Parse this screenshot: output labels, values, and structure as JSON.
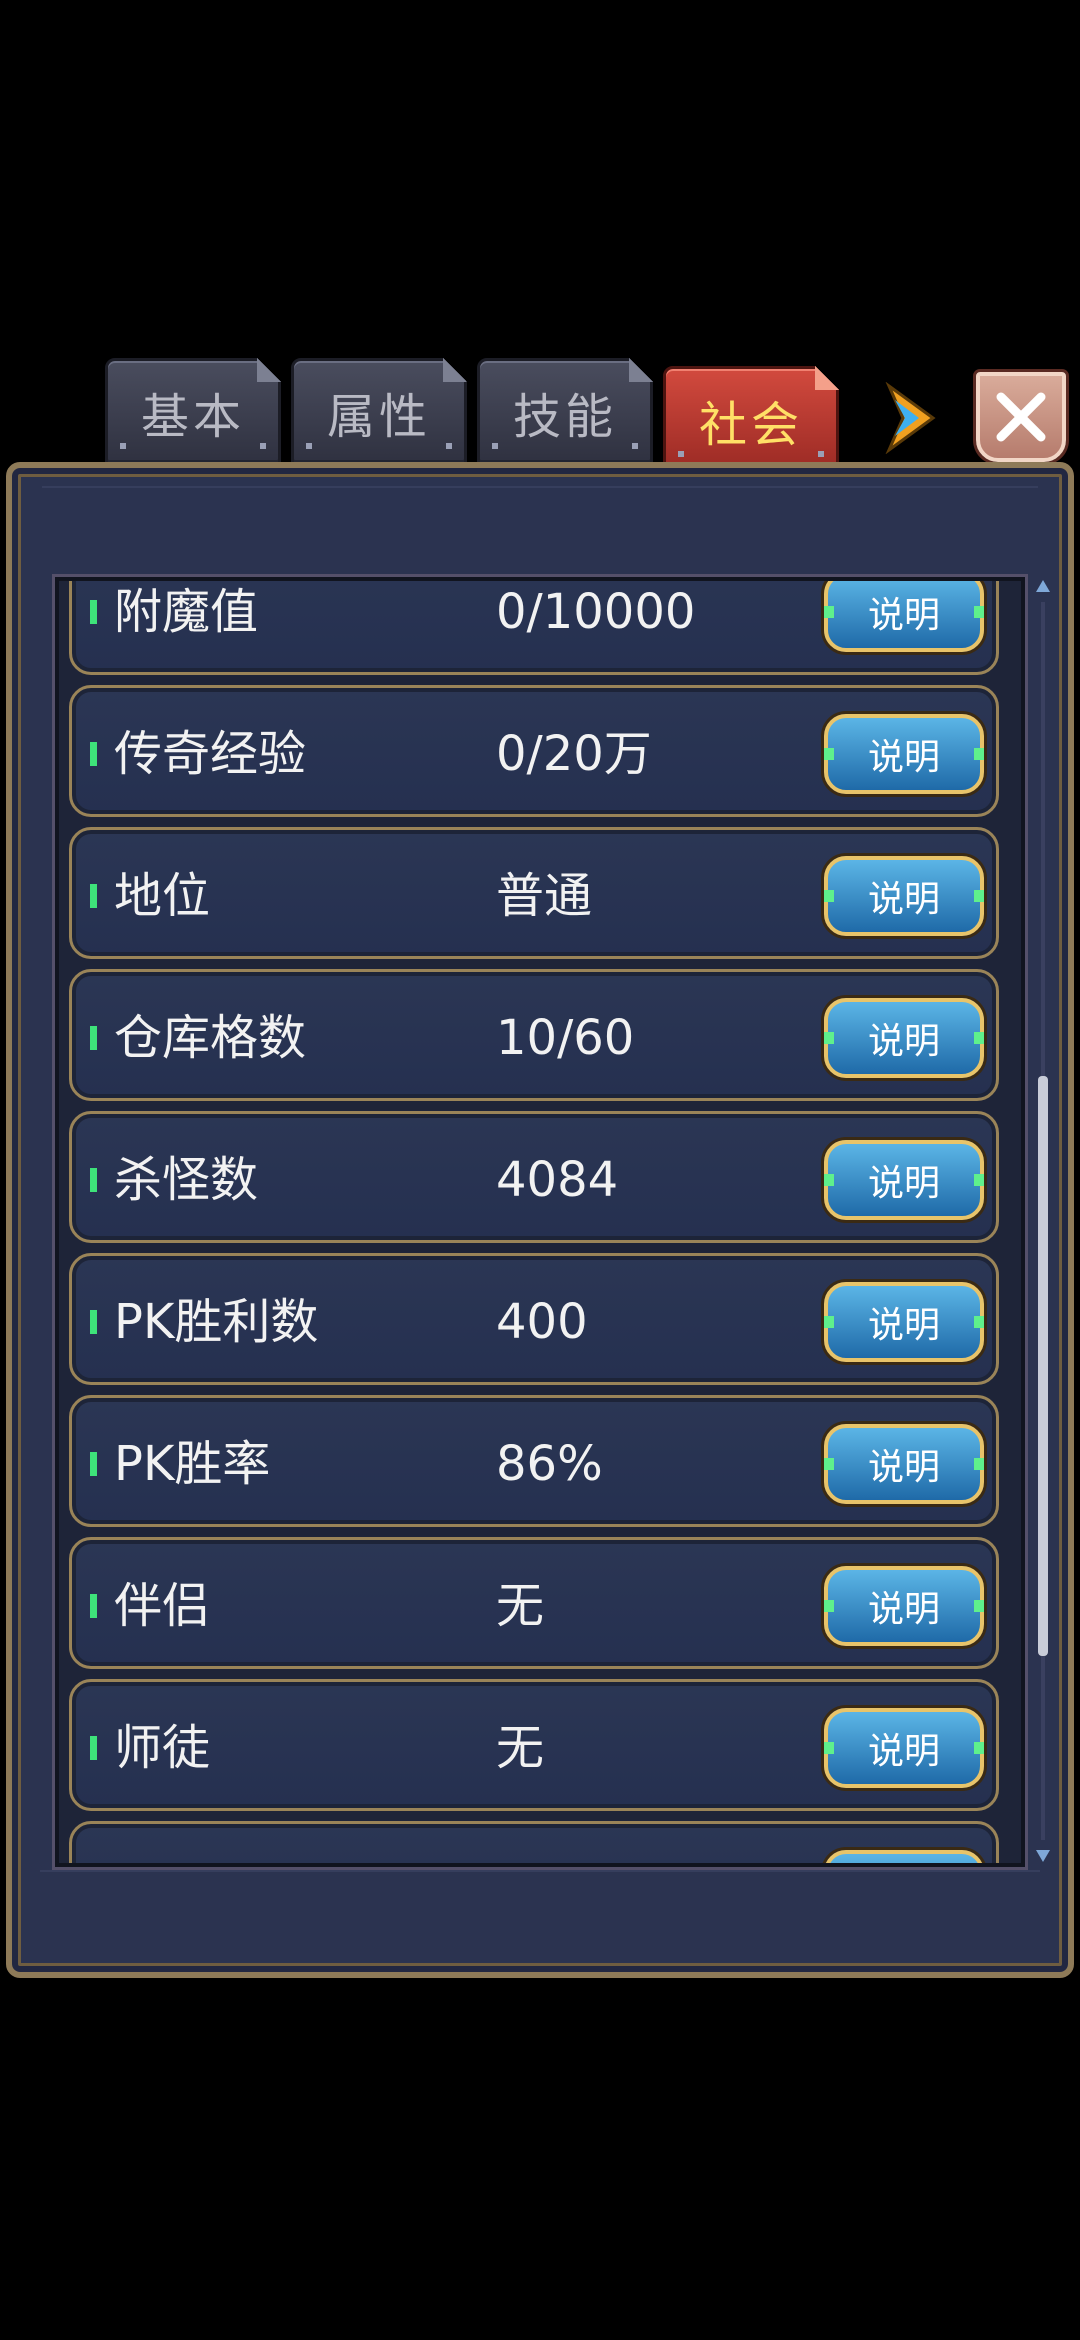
{
  "tabs": [
    {
      "label": "基本",
      "active": false
    },
    {
      "label": "属性",
      "active": false
    },
    {
      "label": "技能",
      "active": false
    },
    {
      "label": "社会",
      "active": true
    }
  ],
  "colors": {
    "active_tab": "#c23a30",
    "active_tab_text": "#ffe067",
    "inactive_tab_text": "#b9bac4",
    "panel_bg": "#2b3350",
    "row_border": "#9a8458",
    "info_button": "#2a7cc0",
    "marker": "#3ee37a"
  },
  "icons": {
    "next": "arrow-right-icon",
    "close": "close-icon"
  },
  "rows": [
    {
      "label": "附魔值",
      "value": "0/10000",
      "button": "说明"
    },
    {
      "label": "传奇经验",
      "value": "0/20万",
      "button": "说明"
    },
    {
      "label": "地位",
      "value": "普通",
      "button": "说明"
    },
    {
      "label": "仓库格数",
      "value": "10/60",
      "button": "说明"
    },
    {
      "label": "杀怪数",
      "value": "4084",
      "button": "说明"
    },
    {
      "label": "PK胜利数",
      "value": "400",
      "button": "说明"
    },
    {
      "label": "PK胜率",
      "value": "86%",
      "button": "说明"
    },
    {
      "label": "伴侣",
      "value": "无",
      "button": "说明"
    },
    {
      "label": "师徒",
      "value": "无",
      "button": "说明"
    }
  ]
}
